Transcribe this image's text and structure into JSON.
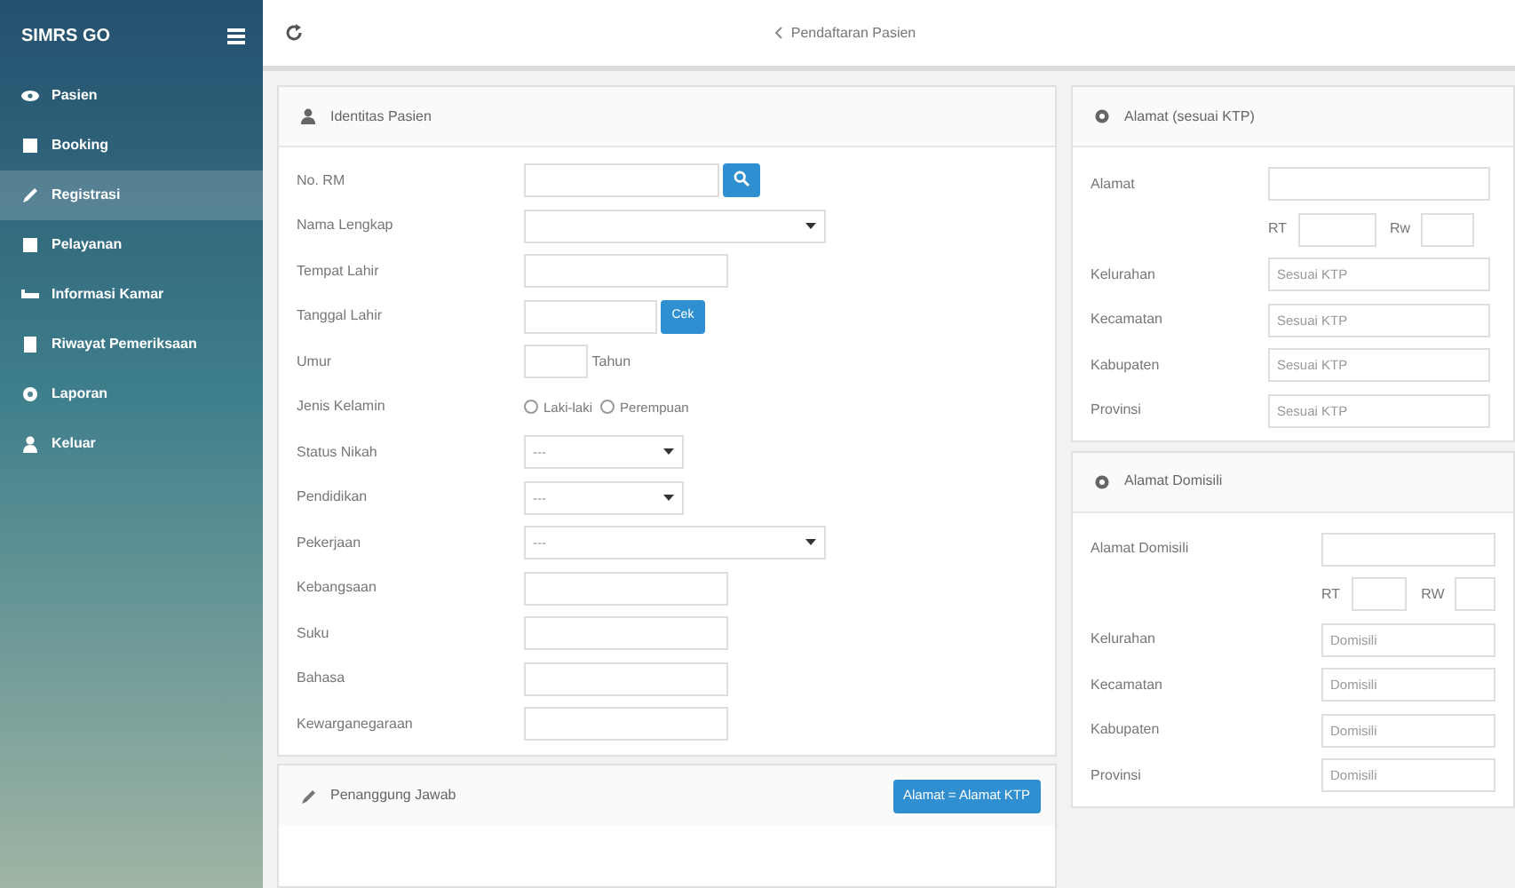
{
  "sidebar": {
    "brand": "SIMRS GO",
    "items": [
      {
        "label": "Pasien",
        "selected": false
      },
      {
        "label": "Booking",
        "selected": false
      },
      {
        "label": "Registrasi",
        "selected": true
      },
      {
        "label": "Pelayanan",
        "selected": false
      },
      {
        "label": "Informasi Kamar",
        "selected": false
      },
      {
        "label": "Riwayat Pemeriksaan",
        "selected": false
      },
      {
        "label": "Laporan",
        "selected": false
      },
      {
        "label": "Keluar",
        "selected": false
      }
    ]
  },
  "topbar": {
    "breadcrumb": "Pendaftaran Pasien"
  },
  "identity": {
    "title": "Identitas Pasien",
    "fields": [
      {
        "label": "No. RM",
        "kind": "search"
      },
      {
        "label": "Nama Lengkap",
        "kind": "select"
      },
      {
        "label": "Tempat Lahir",
        "kind": "text"
      },
      {
        "label": "Tanggal Lahir",
        "kind": "date",
        "button": "Cek"
      },
      {
        "label": "Umur",
        "kind": "age",
        "unit": "Tahun"
      },
      {
        "label": "Jenis Kelamin",
        "kind": "radio",
        "options": [
          {
            "label": "Laki-laki",
            "selected": false
          },
          {
            "label": "Perempuan",
            "selected": false
          }
        ]
      },
      {
        "label": "Status Nikah",
        "kind": "short_select",
        "value": "---"
      },
      {
        "label": "Pendidikan",
        "kind": "short_select",
        "value": "---"
      },
      {
        "label": "Pekerjaan",
        "kind": "select",
        "value": "---"
      },
      {
        "label": "Kebangsaan",
        "kind": "text"
      },
      {
        "label": "Suku",
        "kind": "text"
      },
      {
        "label": "Bahasa",
        "kind": "text"
      },
      {
        "label": "Kewarganegaraan",
        "kind": "text"
      }
    ]
  },
  "ktp_address": {
    "title": "Alamat (sesuai KTP)",
    "fields": [
      {
        "label": "Alamat",
        "kind": "text"
      },
      {
        "kind": "rtrw",
        "rt": "RT",
        "rw": "Rw"
      },
      {
        "label": "Kelurahan",
        "kind": "text",
        "placeholder": "Sesuai KTP"
      },
      {
        "label": "Kecamatan",
        "kind": "text",
        "placeholder": "Sesuai KTP"
      },
      {
        "label": "Kabupaten",
        "kind": "text",
        "placeholder": "Sesuai KTP"
      },
      {
        "label": "Provinsi",
        "kind": "text",
        "placeholder": "Sesuai KTP"
      }
    ]
  },
  "domicile_address": {
    "title": "Alamat Domisili",
    "fields": [
      {
        "label": "Alamat Domisili",
        "kind": "text"
      },
      {
        "kind": "rtrw",
        "rt": "RT",
        "rw": "RW"
      },
      {
        "label": "Kelurahan",
        "kind": "text",
        "placeholder": "Domisili"
      },
      {
        "label": "Kecamatan",
        "kind": "text",
        "placeholder": "Domisili"
      },
      {
        "label": "Kabupaten",
        "kind": "text",
        "placeholder": "Domisili"
      },
      {
        "label": "Provinsi",
        "kind": "text",
        "placeholder": "Domisili"
      }
    ]
  },
  "guarantor": {
    "title": "Penanggung Jawab",
    "button": "Alamat = Alamat KTP"
  }
}
